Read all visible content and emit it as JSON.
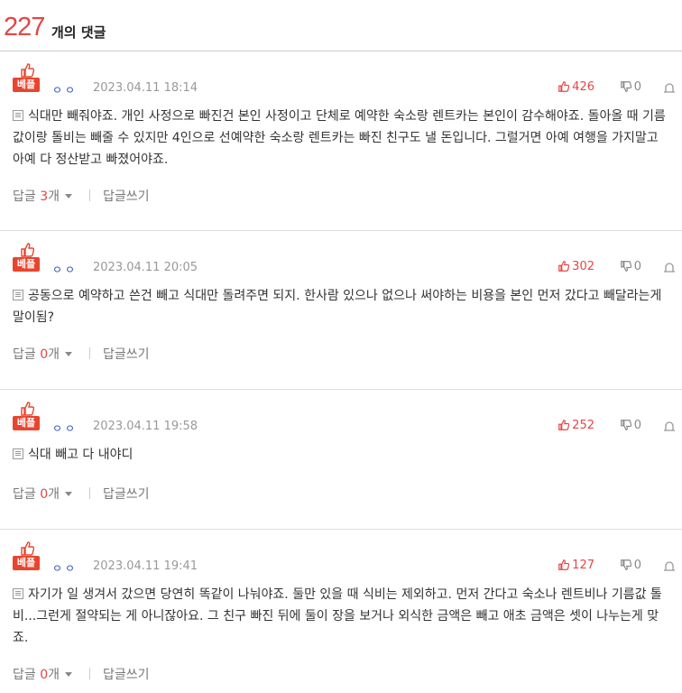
{
  "header": {
    "count": "227",
    "label": "개의 댓글"
  },
  "ui": {
    "best_label": "베플",
    "reply_prefix": "답글 ",
    "reply_suffix": "개",
    "write_reply": "답글쓰기"
  },
  "comments": [
    {
      "nickname": "ㅇㅇ",
      "date": "2023.04.11 18:14",
      "up": "426",
      "down": "0",
      "text": "식대만 빼줘야죠. 개인 사정으로 빠진건 본인 사정이고 단체로 예약한 숙소랑 렌트카는 본인이 감수해야죠. 돌아올 때 기름값이랑 톨비는 빼줄 수 있지만 4인으로 선예약한 숙소랑 렌트카는 빠진 친구도 낼 돈입니다. 그럴거면 아예 여행을 가지말고 아예 다 정산받고 빠졌어야죠.",
      "replies": "3"
    },
    {
      "nickname": "ㅇㅇ",
      "date": "2023.04.11 20:05",
      "up": "302",
      "down": "0",
      "text": "공동으로 예약하고 쓴건 빼고 식대만 돌려주면 되지. 한사람 있으나 없으나 써야하는 비용을 본인 먼저 갔다고 빼달라는게 말이됨?",
      "replies": "0"
    },
    {
      "nickname": "ㅇㅇ",
      "date": "2023.04.11 19:58",
      "up": "252",
      "down": "0",
      "text": "식대 빼고 다 내야디",
      "replies": "0"
    },
    {
      "nickname": "ㅇㅇ",
      "date": "2023.04.11 19:41",
      "up": "127",
      "down": "0",
      "text": "자기가 일 생겨서 갔으면 당연히 똑같이 나눠야죠. 둘만 있을 때 식비는 제외하고. 먼저 간다고 숙소나 렌트비나 기름값 톨비...그런게 절약되는 게 아니잖아요. 그 친구 빠진 뒤에 둘이 장을 보거나 외식한 금액은 빼고 애초 금액은 셋이 나누는게 맞죠.",
      "replies": "0"
    }
  ]
}
